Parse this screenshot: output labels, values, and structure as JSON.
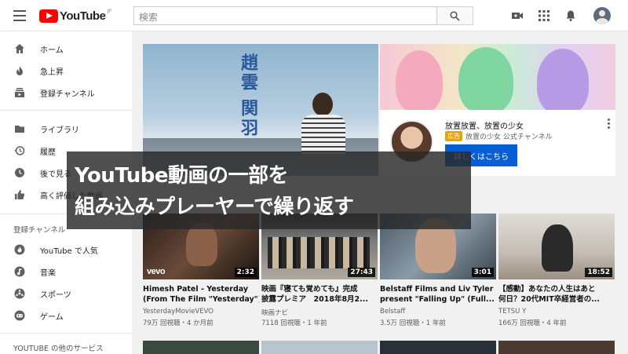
{
  "header": {
    "logo_text": "YouTube",
    "logo_region": "JP",
    "search_placeholder": "検索",
    "icons": [
      "menu-icon",
      "search-icon",
      "video-camera-icon",
      "apps-grid-icon",
      "bell-icon",
      "account-avatar"
    ]
  },
  "sidebar": {
    "main_items": [
      {
        "label": "ホーム",
        "icon": "home-icon"
      },
      {
        "label": "急上昇",
        "icon": "flame-icon"
      },
      {
        "label": "登録チャンネル",
        "icon": "subscriptions-icon"
      }
    ],
    "library_items": [
      {
        "label": "ライブラリ",
        "icon": "folder-icon"
      },
      {
        "label": "履歴",
        "icon": "history-icon"
      },
      {
        "label": "後で見る",
        "icon": "clock-icon"
      },
      {
        "label": "高く評価した動画",
        "icon": "thumbs-up-icon"
      }
    ],
    "subscriptions_heading": "登録チャンネル",
    "subscriptions": [
      {
        "label": "YouTube で人気",
        "icon": "youtube-popular-icon"
      },
      {
        "label": "音楽",
        "icon": "music-icon"
      },
      {
        "label": "スポーツ",
        "icon": "sports-icon"
      },
      {
        "label": "ゲーム",
        "icon": "gaming-icon"
      }
    ],
    "more_heading": "YOUTUBE の他のサービス"
  },
  "banner": {
    "left_text_1": "趙雲",
    "left_text_2": "関羽"
  },
  "ad": {
    "title": "放置放置、放置の少女",
    "badge": "広告",
    "channel": "放置の少女 公式チャンネル",
    "button_label": "詳しくはこちら"
  },
  "overlay": {
    "line1": "YouTube動画の一部を",
    "line2": "組み込みプレーヤーで繰り返す"
  },
  "videos": [
    {
      "title_line1": "Himesh Patel - Yesterday",
      "title_line2": "(From The Film \"Yesterday\")",
      "channel": "YesterdayMovieVEVO",
      "meta": "79万 回視聴・4 か月前",
      "duration": "2:32",
      "vevo": "vevo"
    },
    {
      "title_line1": "映画『寝ても覚めても』完成",
      "title_line2": "披露プレミア　2018年8月2...",
      "channel": "映画ナビ",
      "meta": "7118 回視聴・1 年前",
      "duration": "27:43"
    },
    {
      "title_line1": "Belstaff Films and Liv Tyler",
      "title_line2": "present \"Falling Up\" (Full...",
      "channel": "Belstaff",
      "meta": "3.5万 回視聴・1 年前",
      "duration": "3:01"
    },
    {
      "title_line1": "【感動】あなたの人生はあと",
      "title_line2": "何日？20代MIT卒経営者の...",
      "channel": "TETSU Y",
      "meta": "166万 回視聴・4 年前",
      "duration": "18:52"
    }
  ],
  "colors": {
    "brand_red": "#ff0000",
    "button_blue": "#065fd4",
    "ad_badge": "#e8a400"
  }
}
